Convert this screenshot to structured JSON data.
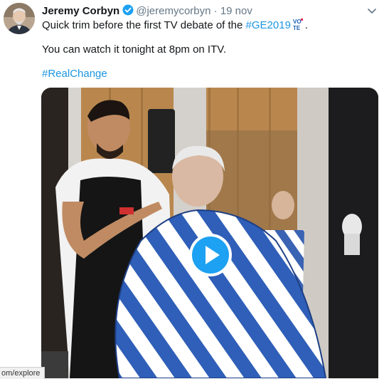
{
  "tweet": {
    "author_name": "Jeremy Corbyn",
    "handle": "@jeremycorbyn",
    "separator": "·",
    "date": "19 nov",
    "line1_text": "Quick trim before the first TV debate of the ",
    "line1_hashtag": "#GE2019",
    "line1_tail": ".",
    "line2_text": "You can watch it tonight at 8pm on ITV.",
    "line3_hashtag": "#RealChange"
  },
  "icons": {
    "verified": "verified-badge-icon",
    "menu": "chevron-down-icon",
    "vote": "vote-emoji-icon",
    "play": "play-icon"
  },
  "colors": {
    "link": "#1b95e0",
    "verified": "#1da1f2",
    "secondary_text": "#657786",
    "play_button": "#1da1f2"
  },
  "status_bar": {
    "url": "om/explore"
  }
}
